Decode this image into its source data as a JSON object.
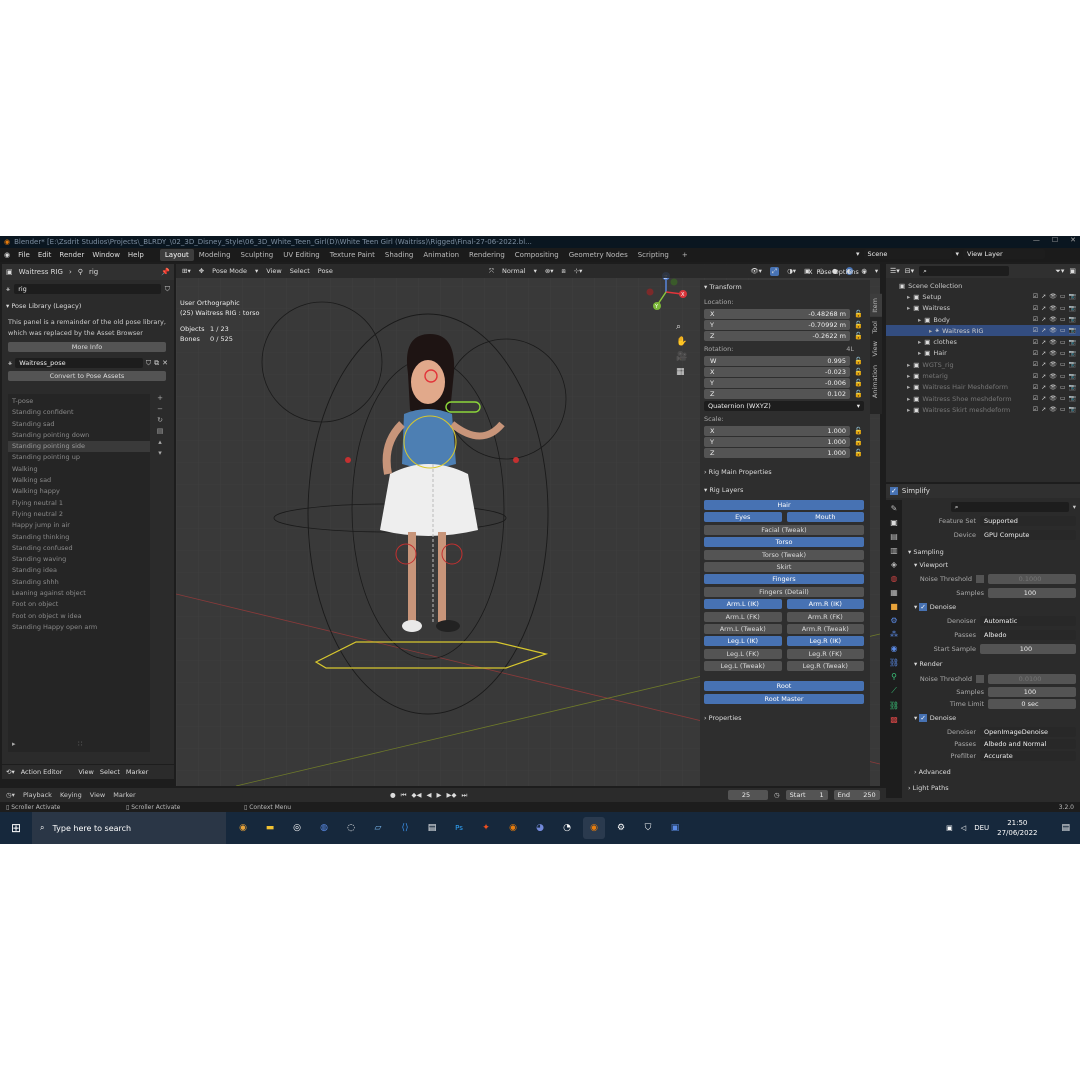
{
  "title_bar": {
    "text": "Blender* [E:\\Zsdrit Studios\\Projects\\_BLRDY_\\02_3D_Disney_Style\\06_3D_White_Teen_Girl(D)\\White Teen Girl (Waitriss)\\Rigged\\Final-27-06-2022.bl..."
  },
  "menu": [
    "File",
    "Edit",
    "Render",
    "Window",
    "Help"
  ],
  "workspaces": [
    "Layout",
    "Modeling",
    "Sculpting",
    "UV Editing",
    "Texture Paint",
    "Shading",
    "Animation",
    "Rendering",
    "Compositing",
    "Geometry Nodes",
    "Scripting"
  ],
  "scene_field": "Scene",
  "view_layer_field": "View Layer",
  "left": {
    "object_name": "Waitress RIG",
    "rig_name": "rig",
    "search_value": "rig",
    "pose_library_title": "Pose Library (Legacy)",
    "notice_line1": "This panel is a remainder of the old pose library,",
    "notice_line2": "which was replaced by the Asset Browser",
    "more_info": "More Info",
    "pose_set": "Waitress_pose",
    "convert_btn": "Convert to Pose Assets",
    "poses": [
      "T-pose",
      "Standing confident",
      "Standing sad",
      "Standing pointing down",
      "Standing pointing side",
      "Standing pointing up",
      "Walking",
      "Walking sad",
      "Walking happy",
      "Flying neutral 1",
      "Flying neutral 2",
      "Happy jump in air",
      "Standing thinking",
      "Standing confused",
      "Standing waving",
      "Standing idea",
      "Standing shhh",
      "Leaning against object",
      "Foot on object",
      "Foot on object w idea",
      "Standing Happy open arm"
    ],
    "selected_pose_index": 4,
    "action_editor": "Action Editor",
    "ae_menu": [
      "View",
      "Select",
      "Marker"
    ],
    "timeline_menu": [
      "Playback",
      "Keying",
      "View",
      "Marker"
    ]
  },
  "viewport": {
    "mode": "Pose Mode",
    "menu": [
      "View",
      "Select",
      "Pose"
    ],
    "orientation": "Normal",
    "view_name": "User Orthographic",
    "active": "(25) Waitress RIG : torso",
    "objects_label": "Objects",
    "objects_val": "1 / 23",
    "bones_label": "Bones",
    "bones_val": "0 / 525",
    "pose_options": "Pose Options",
    "axis_z": "Z",
    "axis_x": "X",
    "axis_y": "Y"
  },
  "npanel": {
    "tabs": [
      "Item",
      "Tool",
      "View",
      "Animation"
    ],
    "transform": "Transform",
    "location_label": "Location:",
    "location": [
      {
        "axis": "X",
        "val": "-0.48268 m"
      },
      {
        "axis": "Y",
        "val": "-0.70992 m"
      },
      {
        "axis": "Z",
        "val": "-0.2622 m"
      }
    ],
    "rotation_label": "Rotation:",
    "rotation_mode_tag": "4L",
    "rotation": [
      {
        "axis": "W",
        "val": "0.995"
      },
      {
        "axis": "X",
        "val": "-0.023"
      },
      {
        "axis": "Y",
        "val": "-0.006"
      },
      {
        "axis": "Z",
        "val": "0.102"
      }
    ],
    "rotation_mode": "Quaternion (WXYZ)",
    "scale_label": "Scale:",
    "scale": [
      {
        "axis": "X",
        "val": "1.000"
      },
      {
        "axis": "Y",
        "val": "1.000"
      },
      {
        "axis": "Z",
        "val": "1.000"
      }
    ],
    "rig_main": "Rig Main Properties",
    "rig_layers": "Rig Layers",
    "layers": [
      [
        {
          "label": "Hair",
          "on": true
        }
      ],
      [
        {
          "label": "Eyes",
          "on": true
        },
        {
          "label": "Mouth",
          "on": true
        }
      ],
      [
        {
          "label": "Facial (Tweak)",
          "on": false
        }
      ],
      [
        {
          "label": "Torso",
          "on": true
        }
      ],
      [
        {
          "label": "Torso (Tweak)",
          "on": false
        }
      ],
      [
        {
          "label": "Skirt",
          "on": false
        }
      ],
      [
        {
          "label": "Fingers",
          "on": true
        }
      ],
      [
        {
          "label": "Fingers (Detail)",
          "on": false
        }
      ],
      [
        {
          "label": "Arm.L (IK)",
          "on": true
        },
        {
          "label": "Arm.R (IK)",
          "on": true
        }
      ],
      [
        {
          "label": "Arm.L (FK)",
          "on": false
        },
        {
          "label": "Arm.R (FK)",
          "on": false
        }
      ],
      [
        {
          "label": "Arm.L (Tweak)",
          "on": false
        },
        {
          "label": "Arm.R (Tweak)",
          "on": false
        }
      ],
      [
        {
          "label": "Leg.L (IK)",
          "on": true
        },
        {
          "label": "Leg.R (IK)",
          "on": true
        }
      ],
      [
        {
          "label": "Leg.L (FK)",
          "on": false
        },
        {
          "label": "Leg.R (FK)",
          "on": false
        }
      ],
      [
        {
          "label": "Leg.L (Tweak)",
          "on": false
        },
        {
          "label": "Leg.R (Tweak)",
          "on": false
        }
      ]
    ],
    "root": "Root",
    "root_master": "Root Master",
    "properties": "Properties"
  },
  "outliner": {
    "items": [
      {
        "label": "Scene Collection",
        "indent": 0,
        "hl": false,
        "dim": false
      },
      {
        "label": "Setup",
        "indent": 1,
        "hl": false,
        "dim": false
      },
      {
        "label": "Waitress",
        "indent": 1,
        "hl": false,
        "dim": false
      },
      {
        "label": "Body",
        "indent": 2,
        "hl": false,
        "dim": false
      },
      {
        "label": "Waitress RIG",
        "indent": 3,
        "hl": true,
        "dim": false
      },
      {
        "label": "clothes",
        "indent": 2,
        "hl": false,
        "dim": false
      },
      {
        "label": "Hair",
        "indent": 2,
        "hl": false,
        "dim": false
      },
      {
        "label": "WGTS_rig",
        "indent": 1,
        "hl": false,
        "dim": true
      },
      {
        "label": "metarig",
        "indent": 1,
        "hl": false,
        "dim": true
      },
      {
        "label": "Waitress Hair Meshdeform",
        "indent": 1,
        "hl": false,
        "dim": true
      },
      {
        "label": "Waitress Shoe meshdeform",
        "indent": 1,
        "hl": false,
        "dim": true
      },
      {
        "label": "Waitress Skirt meshdeform",
        "indent": 1,
        "hl": false,
        "dim": true
      }
    ]
  },
  "props": {
    "simplify": "Simplify",
    "feature_set_label": "Feature Set",
    "feature_set": "Supported",
    "device_label": "Device",
    "device": "GPU Compute",
    "sampling": "Sampling",
    "viewport": "Viewport",
    "noise_threshold": "Noise Threshold",
    "vp_noise": "0.1000",
    "samples": "Samples",
    "vp_samples": "100",
    "denoise": "Denoise",
    "denoiser": "Denoiser",
    "vp_denoiser": "Automatic",
    "passes": "Passes",
    "vp_passes": "Albedo",
    "start_sample": "Start Sample",
    "vp_start": "100",
    "render": "Render",
    "r_noise": "0.0100",
    "r_samples": "100",
    "time_limit": "Time Limit",
    "r_time": "0 sec",
    "r_denoiser": "OpenImageDenoise",
    "r_passes": "Albedo and Normal",
    "prefilter": "Prefilter",
    "r_prefilter": "Accurate",
    "advanced": "Advanced",
    "light_paths": "Light Paths"
  },
  "timeline": {
    "frame": "25",
    "start_label": "Start",
    "start": "1",
    "end_label": "End",
    "end": "250"
  },
  "status": {
    "left1": "Scroller Activate",
    "left2": "Scroller Activate",
    "mid": "Context Menu",
    "version": "3.2.0"
  },
  "taskbar": {
    "search": "Type here to search",
    "lang": "DEU",
    "time": "21:50",
    "date": "27/06/2022"
  },
  "colors": {
    "accent": "#4772b3",
    "panel": "#2b2b2b",
    "viewport": "#3a3a3a",
    "taskbar": "#16283c"
  }
}
